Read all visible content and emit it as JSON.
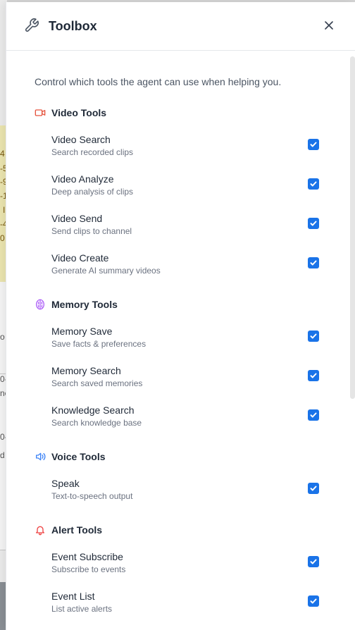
{
  "background": {
    "fragments": [
      "4",
      "-5",
      "-9",
      "-1",
      "I",
      "-4",
      "0",
      "o",
      "0-",
      "ne",
      "0-",
      "d"
    ]
  },
  "header": {
    "title": "Toolbox",
    "icon": "wrench-icon",
    "close_icon": "close-icon"
  },
  "intro": "Control which tools the agent can use when helping you.",
  "sections": [
    {
      "title": "Video Tools",
      "icon": "video-camera-icon",
      "color": "#e5533d",
      "tools": [
        {
          "name": "Video Search",
          "description": "Search recorded clips",
          "enabled": true
        },
        {
          "name": "Video Analyze",
          "description": "Deep analysis of clips",
          "enabled": true
        },
        {
          "name": "Video Send",
          "description": "Send clips to channel",
          "enabled": true
        },
        {
          "name": "Video Create",
          "description": "Generate AI summary videos",
          "enabled": true
        }
      ]
    },
    {
      "title": "Memory Tools",
      "icon": "brain-icon",
      "color": "#a855f7",
      "tools": [
        {
          "name": "Memory Save",
          "description": "Save facts & preferences",
          "enabled": true
        },
        {
          "name": "Memory Search",
          "description": "Search saved memories",
          "enabled": true
        },
        {
          "name": "Knowledge Search",
          "description": "Search knowledge base",
          "enabled": true
        }
      ]
    },
    {
      "title": "Voice Tools",
      "icon": "speaker-icon",
      "color": "#3b82f6",
      "tools": [
        {
          "name": "Speak",
          "description": "Text-to-speech output",
          "enabled": true
        }
      ]
    },
    {
      "title": "Alert Tools",
      "icon": "bell-icon",
      "color": "#ef4444",
      "tools": [
        {
          "name": "Event Subscribe",
          "description": "Subscribe to events",
          "enabled": true
        },
        {
          "name": "Event List",
          "description": "List active alerts",
          "enabled": true
        }
      ]
    }
  ],
  "checkbox_color": "#1a73e8"
}
